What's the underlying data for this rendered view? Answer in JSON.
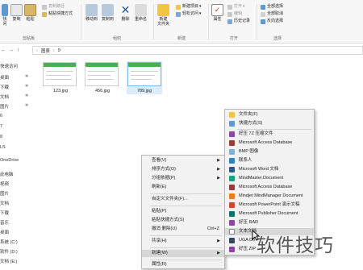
{
  "ribbon": {
    "clipboard": {
      "pin_label": "快",
      "pin_label_2": "问",
      "copy_label": "复制",
      "paste_label": "粘贴",
      "copy_path": "复制路径",
      "paste_shortcut": "粘贴快捷方式",
      "group_label": "剪贴板"
    },
    "organize": {
      "move_to": "移动到",
      "copy_to": "复制到",
      "delete": "删除",
      "rename": "重命名",
      "group_label": "组织"
    },
    "new": {
      "new_folder_line1": "新建",
      "new_folder_line2": "文件夹",
      "new_item": "新建项目",
      "easy_access": "轻松访问",
      "group_label": "新建"
    },
    "open": {
      "properties": "属性",
      "open": "打开",
      "edit": "编辑",
      "history": "历史记录",
      "group_label": "打开"
    },
    "select": {
      "select_all": "全部选择",
      "select_none": "全部取消",
      "invert": "反向选择",
      "group_label": "选择"
    }
  },
  "address": {
    "back": "←",
    "forward": "→",
    "up": "↑",
    "crumbs": [
      "图表",
      "9"
    ]
  },
  "nav_pane": {
    "items": [
      "快速访问",
      "桌面",
      "下载",
      "文档",
      "图片",
      "6",
      "7",
      "8",
      "LS",
      "OneDrive",
      "此电脑",
      "视频",
      "图片",
      "文档",
      "下载",
      "音乐",
      "桌面",
      "系统 (C:)",
      "软件 (D:)",
      "文档 (E:)"
    ]
  },
  "files": [
    {
      "name": "123.jpg"
    },
    {
      "name": "456.jpg"
    },
    {
      "name": "789.jpg"
    }
  ],
  "context_menu": {
    "view": "查看(V)",
    "sort_by": "排序方式(O)",
    "group_by": "分组依据(P)",
    "refresh": "刷新(E)",
    "customize": "自定义文件夹(F)...",
    "paste": "粘贴(P)",
    "paste_shortcut": "粘贴快捷方式(S)",
    "undo_delete": "撤消 删除(U)",
    "undo_shortcut": "Ctrl+Z",
    "share": "共享(H)",
    "new": "新建(W)",
    "properties": "属性(R)"
  },
  "submenu": {
    "folder": "文件夹(F)",
    "shortcut": "快捷方式(S)",
    "zip7": "好压 7Z 压缩文件",
    "access_db": "Microsoft Access Database",
    "bmp": "BMP 图像",
    "contact": "联系人",
    "word": "Microsoft Word 文档",
    "mindmaster": "MindMaster.Document",
    "access_db2": "Microsoft Access Database",
    "mindjet": "Mindjet MindManager Document",
    "ppt": "Microsoft PowerPoint 演示文稿",
    "rar": "好压 RAR",
    "publisher": "Microsoft Publisher Document",
    "text": "文本文档",
    "uga": "UGA Do",
    "zip": "好压 ZIP"
  },
  "watermark": "软件技巧",
  "colors": {
    "ribbon_bg": "#f7f7f7",
    "menu_bg": "#f2f2f2",
    "selection": "#dcecfc",
    "excel_green": "#4caf50"
  }
}
